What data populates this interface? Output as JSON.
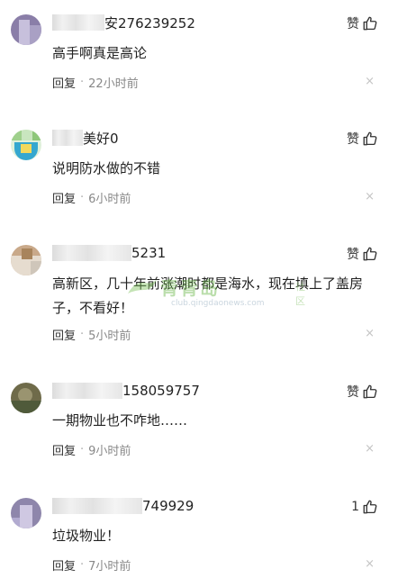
{
  "comments": [
    {
      "name": "安276239252",
      "text": "高手啊真是高论",
      "like_label": "赞",
      "reply": "回复",
      "time": "22小时前"
    },
    {
      "name": "美好0",
      "text": "说明防水做的不错",
      "like_label": "赞",
      "reply": "回复",
      "time": "6小时前"
    },
    {
      "name": "5231",
      "text": "高新区，几十年前涨潮时都是海水，现在填上了盖房子，不看好！",
      "like_label": "赞",
      "reply": "回复",
      "time": "5小时前"
    },
    {
      "name": "158059757",
      "text": "一期物业也不咋地……",
      "like_label": "赞",
      "reply": "回复",
      "time": "9小时前"
    },
    {
      "name": "749929",
      "text": "垃圾物业！",
      "like_label": "1",
      "reply": "回复",
      "time": "7小时前"
    }
  ],
  "separator": "·",
  "close_glyph": "×",
  "watermark": {
    "brand": "青青岛",
    "sub": "社区",
    "url": "club.qingdaonews.com"
  },
  "colors": {
    "text": "#222222",
    "muted": "#888888",
    "close": "#c4c4c4"
  }
}
